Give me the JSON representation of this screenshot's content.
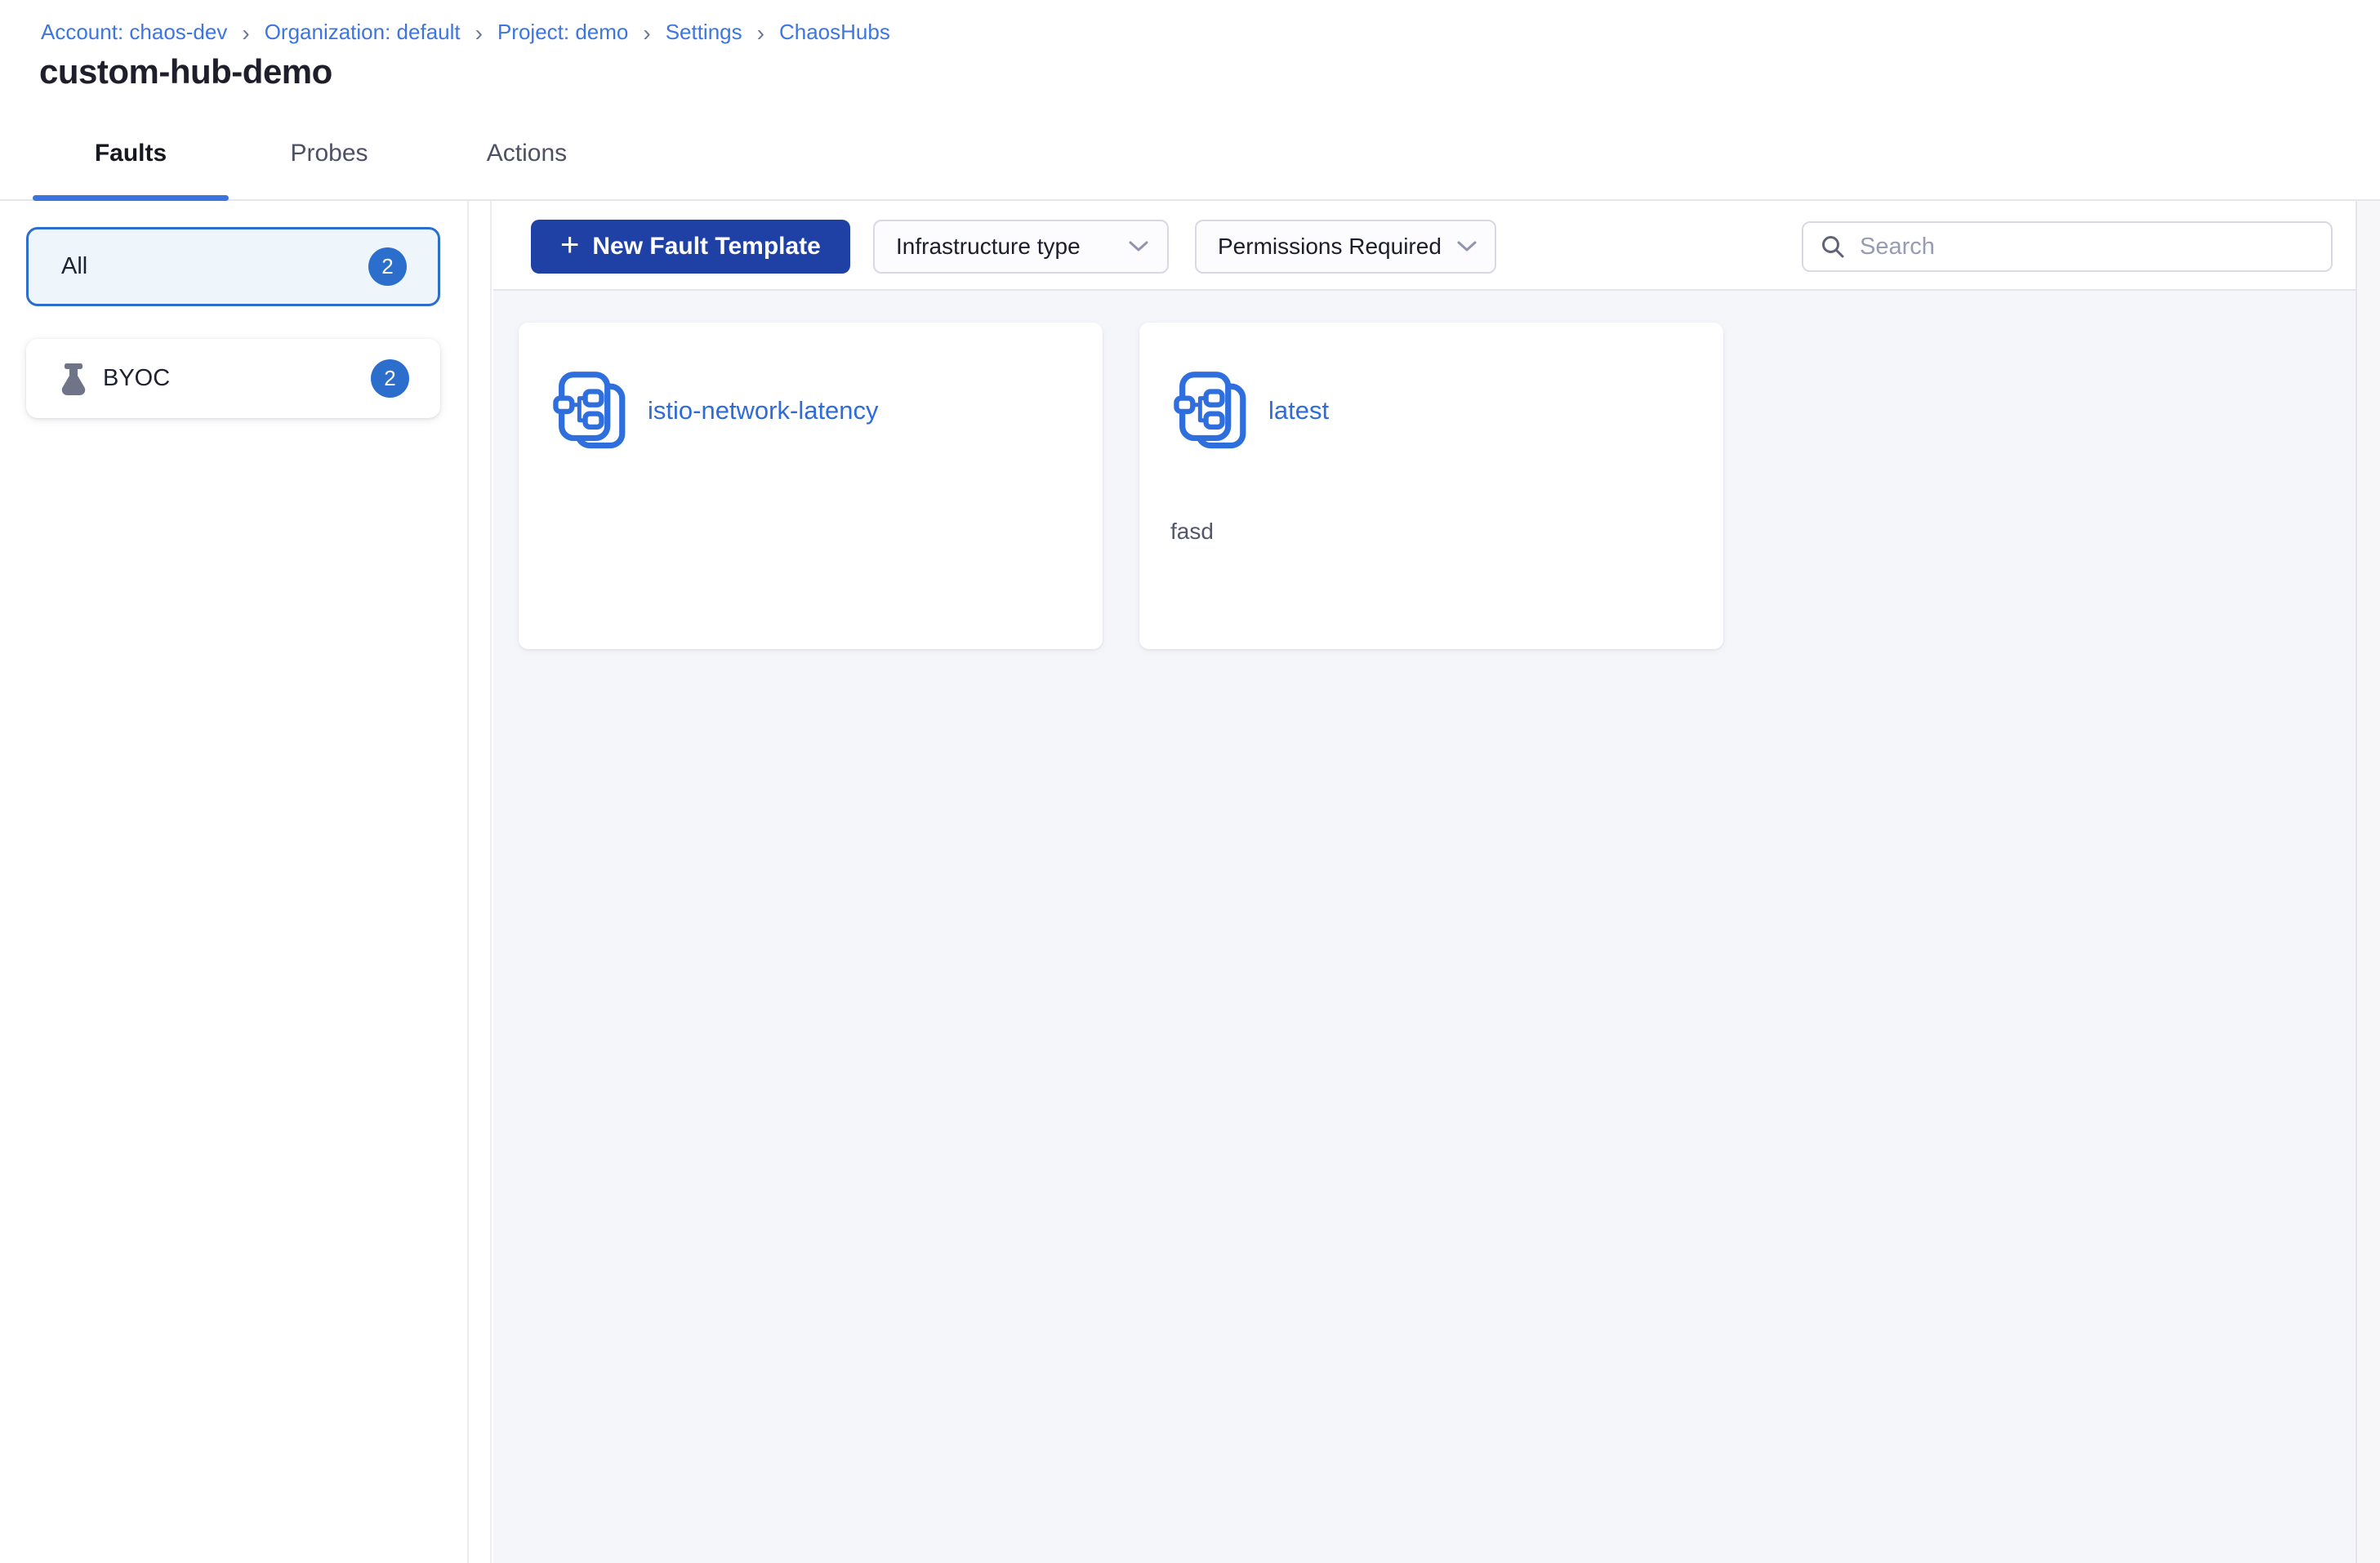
{
  "breadcrumb": {
    "separator": "›",
    "items": [
      {
        "label": "Account: chaos-dev"
      },
      {
        "label": "Organization: default"
      },
      {
        "label": "Project: demo"
      },
      {
        "label": "Settings"
      },
      {
        "label": "ChaosHubs"
      }
    ]
  },
  "page": {
    "title": "custom-hub-demo"
  },
  "tabs": [
    {
      "label": "Faults",
      "active": true
    },
    {
      "label": "Probes",
      "active": false
    },
    {
      "label": "Actions",
      "active": false
    }
  ],
  "sidebar": {
    "filters": [
      {
        "label": "All",
        "count": "2",
        "selected": true
      },
      {
        "label": "BYOC",
        "count": "2",
        "selected": false,
        "icon": "flask-icon"
      }
    ]
  },
  "toolbar": {
    "new_template_button": {
      "plus_glyph": "+",
      "label": "New Fault Template"
    },
    "selects": [
      {
        "label": "Infrastructure type"
      },
      {
        "label": "Permissions Required"
      }
    ],
    "search": {
      "placeholder": "Search"
    }
  },
  "cards": [
    {
      "title": "istio-network-latency",
      "description": "",
      "icon": "fault-template-icon"
    },
    {
      "title": "latest",
      "description": "fasd",
      "icon": "fault-template-icon"
    }
  ],
  "colors": {
    "primary_button": "#1f41a5",
    "badge_blue": "#2c6ecb",
    "selected_filter_bg": "#eef6fc",
    "selected_filter_border": "#2c6ecb",
    "breadcrumb_link": "#3d76e0",
    "card_title_link": "#2f6bd9",
    "tab_underline": "#3b74dc",
    "hub_icon_blue": "#2e6fdd",
    "flask_gray": "#6f7489",
    "content_bg": "#f5f6fa"
  }
}
